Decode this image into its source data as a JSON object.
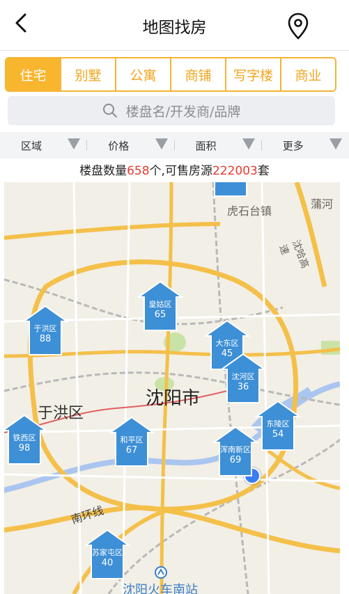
{
  "header": {
    "title": "地图找房",
    "back_icon": "chevron-left-icon",
    "location_icon": "location-pin-icon"
  },
  "tabs": [
    {
      "label": "住宅",
      "active": true
    },
    {
      "label": "别墅",
      "active": false
    },
    {
      "label": "公寓",
      "active": false
    },
    {
      "label": "商铺",
      "active": false
    },
    {
      "label": "写字楼",
      "active": false
    },
    {
      "label": "商业",
      "active": false
    }
  ],
  "search": {
    "placeholder": "楼盘名/开发商/品牌"
  },
  "filters": [
    "区域",
    "价格",
    "面积",
    "更多"
  ],
  "summary": {
    "prefix": "楼盘数量",
    "buildings": "658",
    "middle": "个,可售房源",
    "units": "222003",
    "suffix": "套"
  },
  "map": {
    "city_label": "沈阳市",
    "labels": {
      "yuhong": "于洪区",
      "hutai": "虎石台镇",
      "pushe": "蒲河",
      "highway": "沈哈高速",
      "ring": "南环线",
      "station": "沈阳火车南站"
    },
    "markers": [
      {
        "name": "皇姑区",
        "count": "65"
      },
      {
        "name": "于洪区",
        "count": "88"
      },
      {
        "name": "大东区",
        "count": "45"
      },
      {
        "name": "沈河区",
        "count": "36"
      },
      {
        "name": "东陵区",
        "count": "54"
      },
      {
        "name": "铁西区",
        "count": "98"
      },
      {
        "name": "和平区",
        "count": "67"
      },
      {
        "name": "浑南新区",
        "count": "69"
      },
      {
        "name": "苏家屯区",
        "count": "40"
      }
    ],
    "colors": {
      "road": "#f4c04a",
      "marker": "#3d8fd6",
      "water": "#aac6f0",
      "park": "#c9e3a6"
    }
  }
}
